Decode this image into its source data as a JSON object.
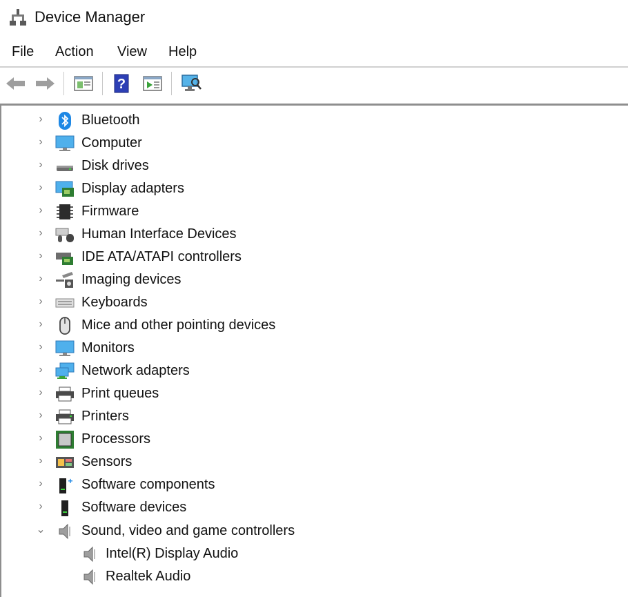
{
  "window": {
    "title": "Device Manager"
  },
  "menu": {
    "file": "File",
    "action": "Action",
    "view": "View",
    "help": "Help"
  },
  "toolbar": {
    "help_label": "?"
  },
  "tree": {
    "bluetooth": "Bluetooth",
    "computer": "Computer",
    "disk_drives": "Disk drives",
    "display_adapters": "Display adapters",
    "firmware": "Firmware",
    "hid": "Human Interface Devices",
    "ide": "IDE ATA/ATAPI controllers",
    "imaging": "Imaging devices",
    "keyboards": "Keyboards",
    "mice": "Mice and other pointing devices",
    "monitors": "Monitors",
    "network": "Network adapters",
    "print_queues": "Print queues",
    "printers": "Printers",
    "processors": "Processors",
    "sensors": "Sensors",
    "software_components": "Software components",
    "software_devices": "Software devices",
    "sound": "Sound, video and game controllers",
    "sound_child_1": "Intel(R) Display Audio",
    "sound_child_2": "Realtek Audio"
  },
  "colors": {
    "accent": "#1e88e5",
    "tree_border": "#8e8e8e"
  },
  "icons": {
    "app": "device-manager-icon",
    "back": "back-arrow-icon",
    "forward": "forward-arrow-icon",
    "properties": "properties-icon",
    "help": "help-icon",
    "update_driver": "update-driver-icon",
    "scan": "scan-hardware-icon"
  }
}
